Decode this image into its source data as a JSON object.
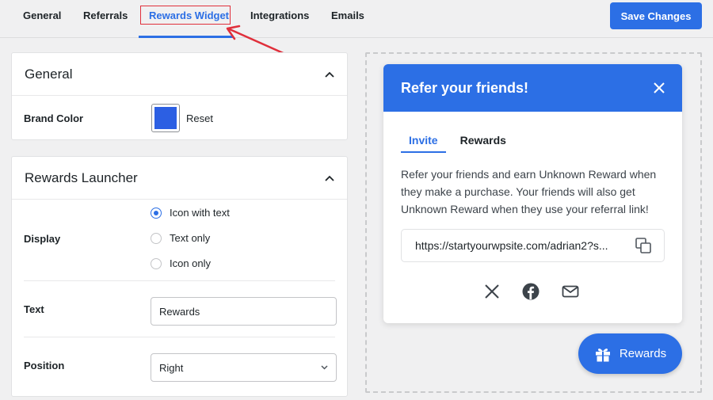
{
  "nav": {
    "tabs": [
      "General",
      "Referrals",
      "Rewards Widget",
      "Integrations",
      "Emails"
    ],
    "active_tab": "Rewards Widget",
    "save_label": "Save Changes"
  },
  "general_panel": {
    "title": "General",
    "brand_color_label": "Brand Color",
    "brand_color": "#2c5fe3",
    "reset_label": "Reset"
  },
  "launcher_panel": {
    "title": "Rewards Launcher",
    "display_label": "Display",
    "display_options": [
      "Icon with text",
      "Text only",
      "Icon only"
    ],
    "display_selected": "Icon with text",
    "text_label": "Text",
    "text_value": "Rewards",
    "position_label": "Position",
    "position_value": "Right"
  },
  "widget": {
    "title": "Refer your friends!",
    "tabs": [
      "Invite",
      "Rewards"
    ],
    "active_tab": "Invite",
    "description": "Refer your friends and earn Unknown Reward when they make a purchase. Your friends will also get Unknown Reward when they use your referral link!",
    "link": "https://startyourwpsite.com/adrian2?s...",
    "share_icons": [
      "x-icon",
      "facebook-icon",
      "mail-icon"
    ]
  },
  "launcher_button": {
    "label": "Rewards"
  },
  "colors": {
    "accent": "#2c6fe5",
    "annotation": "#e02f3b"
  }
}
